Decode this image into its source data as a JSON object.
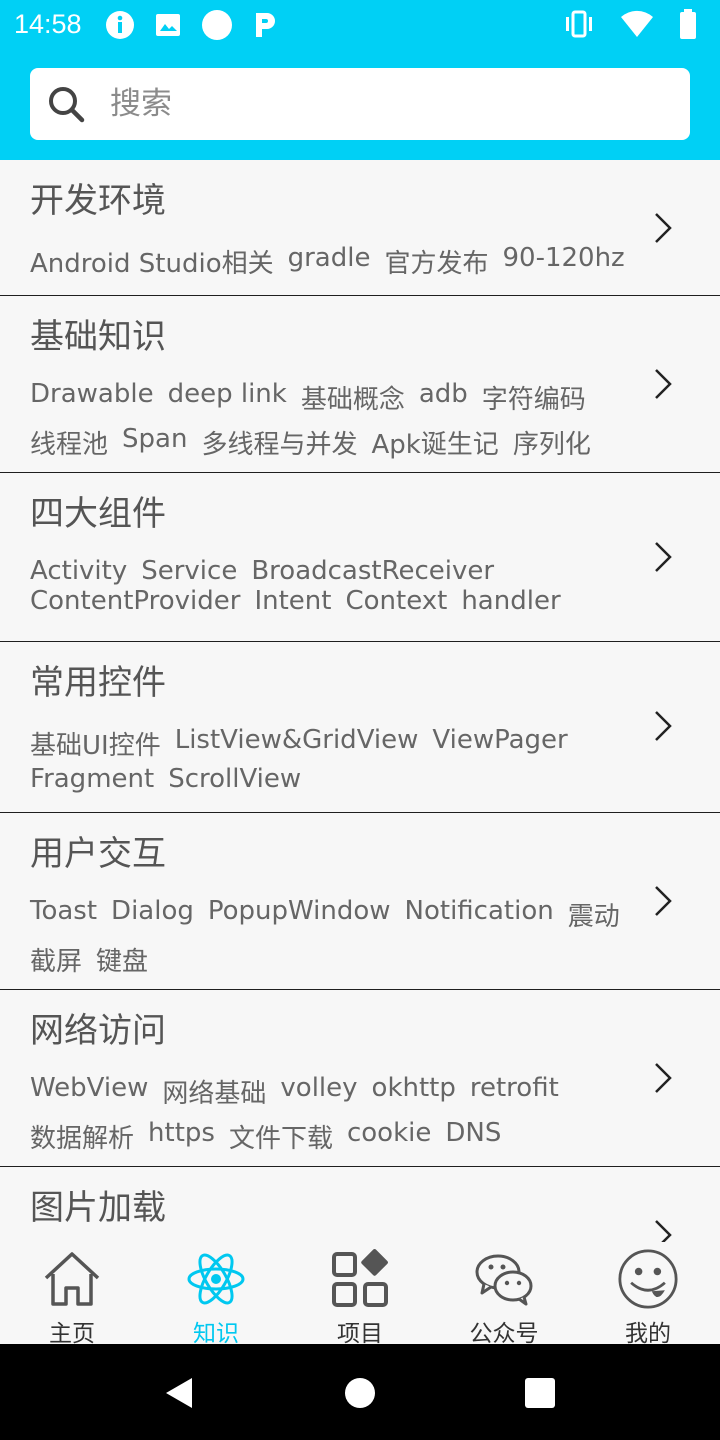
{
  "status_bar": {
    "time": "14:58",
    "left_icons": [
      "info-icon",
      "image-icon",
      "circle-icon",
      "p-icon"
    ],
    "right_icons": [
      "vibrate-icon",
      "wifi-icon",
      "battery-icon"
    ]
  },
  "search": {
    "placeholder": "搜索"
  },
  "categories": [
    {
      "title": "开发环境",
      "tags": [
        "Android Studio相关",
        "gradle",
        "官方发布",
        "90-120hz"
      ]
    },
    {
      "title": "基础知识",
      "tags": [
        "Drawable",
        "deep link",
        "基础概念",
        "adb",
        "字符编码",
        "线程池",
        "Span",
        "多线程与并发",
        "Apk诞生记",
        "序列化"
      ]
    },
    {
      "title": "四大组件",
      "tags": [
        "Activity",
        "Service",
        "BroadcastReceiver",
        "ContentProvider",
        "Intent",
        "Context",
        "handler"
      ]
    },
    {
      "title": "常用控件",
      "tags": [
        "基础UI控件",
        "ListView&GridView",
        "ViewPager",
        "Fragment",
        "ScrollView"
      ]
    },
    {
      "title": "用户交互",
      "tags": [
        "Toast",
        "Dialog",
        "PopupWindow",
        "Notification",
        "震动",
        "截屏",
        "键盘"
      ]
    },
    {
      "title": "网络访问",
      "tags": [
        "WebView",
        "网络基础",
        "volley",
        "okhttp",
        "retrofit",
        "数据解析",
        "https",
        "文件下载",
        "cookie",
        "DNS"
      ]
    },
    {
      "title": "图片加载",
      "tags": []
    }
  ],
  "bottom_nav": [
    {
      "label": "主页",
      "icon": "home-icon",
      "active": false
    },
    {
      "label": "知识",
      "icon": "atom-icon",
      "active": true
    },
    {
      "label": "项目",
      "icon": "grid-icon",
      "active": false
    },
    {
      "label": "公众号",
      "icon": "wechat-icon",
      "active": false
    },
    {
      "label": "我的",
      "icon": "smiley-icon",
      "active": false
    }
  ],
  "colors": {
    "accent": "#00d0f5",
    "active_tab": "#00c8f0",
    "text": "#555555"
  }
}
